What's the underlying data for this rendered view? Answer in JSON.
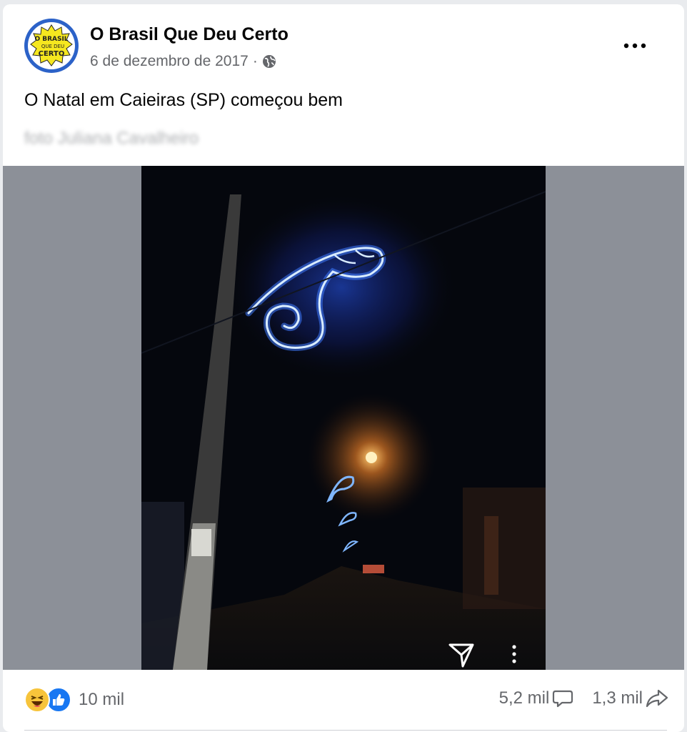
{
  "post": {
    "page_name": "O Brasil Que Deu Certo",
    "date": "6 de dezembro de 2017",
    "separator": "·",
    "privacy_icon": "globe-icon",
    "text": "O Natal em Caieiras (SP) começou bem",
    "photo_credit": "foto Juliana Cavalheiro",
    "avatar_logo_text": [
      "O BRASIL",
      "QUE DEU",
      "CERTO"
    ]
  },
  "media": {
    "icons": [
      "send-icon",
      "kebab-menu-icon"
    ]
  },
  "footer": {
    "reaction_icons": [
      "haha-icon",
      "like-icon"
    ],
    "reaction_count": "10 mil",
    "comment_count": "5,2 mil",
    "share_count": "1,3 mil"
  },
  "colors": {
    "brand_blue": "#1877f2",
    "avatar_ring": "#2c62c8",
    "avatar_yellow": "#f5e71f",
    "secondary_text": "#65676b",
    "media_bg": "#8c9098"
  }
}
